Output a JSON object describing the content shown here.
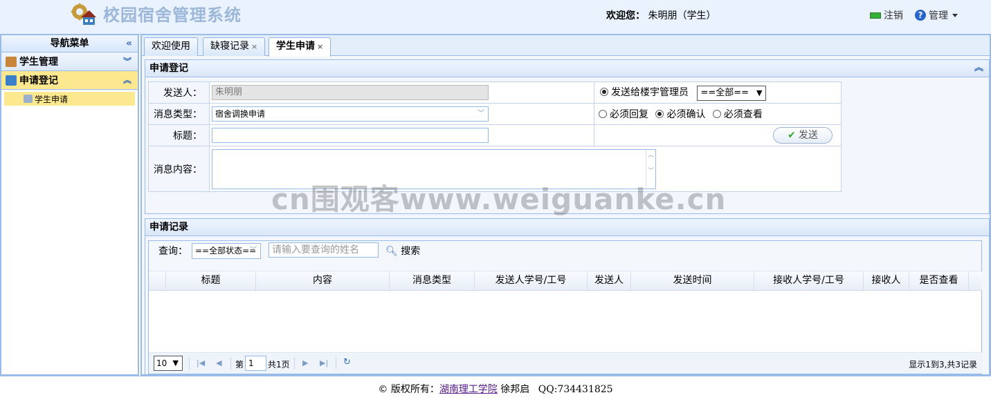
{
  "header": {
    "app_title": "校园宿舍管理系统",
    "welcome_label": "欢迎您：",
    "user_display": "朱明朋（学生）",
    "logout_label": "注销",
    "manage_label": "管理"
  },
  "sidebar": {
    "title": "导航菜单",
    "sections": [
      {
        "label": "学生管理",
        "icon": "student-icon"
      },
      {
        "label": "申请登记",
        "icon": "register-icon",
        "items": [
          {
            "label": "学生申请"
          }
        ]
      }
    ]
  },
  "tabs": [
    {
      "label": "欢迎使用",
      "closable": false
    },
    {
      "label": "缺寝记录",
      "closable": true
    },
    {
      "label": "学生申请",
      "closable": true,
      "active": true
    }
  ],
  "apply_panel": {
    "title": "申请登记",
    "sender_label": "发送人：",
    "sender_value": "朱明朋",
    "msg_type_label": "消息类型：",
    "msg_type_value": "宿舍调换申请",
    "subject_label": "标题：",
    "subject_value": "",
    "content_label": "消息内容：",
    "send_to_label": "发送给楼宇管理员",
    "send_to_select": "==全部==",
    "options": [
      {
        "label": "必须回复",
        "checked": false
      },
      {
        "label": "必须确认",
        "checked": true
      },
      {
        "label": "必须查看",
        "checked": false
      }
    ],
    "send_button": "发送"
  },
  "records_panel": {
    "title": "申请记录",
    "query_label": "查询：",
    "status_select": "==全部状态==",
    "name_placeholder": "请输入要查询的姓名",
    "search_button": "搜索",
    "columns": [
      "标题",
      "内容",
      "消息类型",
      "发送人学号/工号",
      "发送人",
      "发送时间",
      "接收人学号/工号",
      "接收人",
      "是否查看"
    ],
    "rows": [],
    "pager": {
      "page_size": "10",
      "page_prefix": "第",
      "page_number": "1",
      "page_total": "共1页",
      "summary": "显示1到3,共3记录"
    }
  },
  "watermark": "cn围观客www.weiguanke.cn",
  "footer": {
    "copyright": "© 版权所有：",
    "org": "湖南理工学院",
    "author": "徐邦启",
    "qq": "QQ:734431825"
  },
  "colors": {
    "header_bg": "#eaf2fe",
    "border": "#99bbe8",
    "active_menu": "#fbe88f",
    "title_color": "#9cb7d8"
  }
}
